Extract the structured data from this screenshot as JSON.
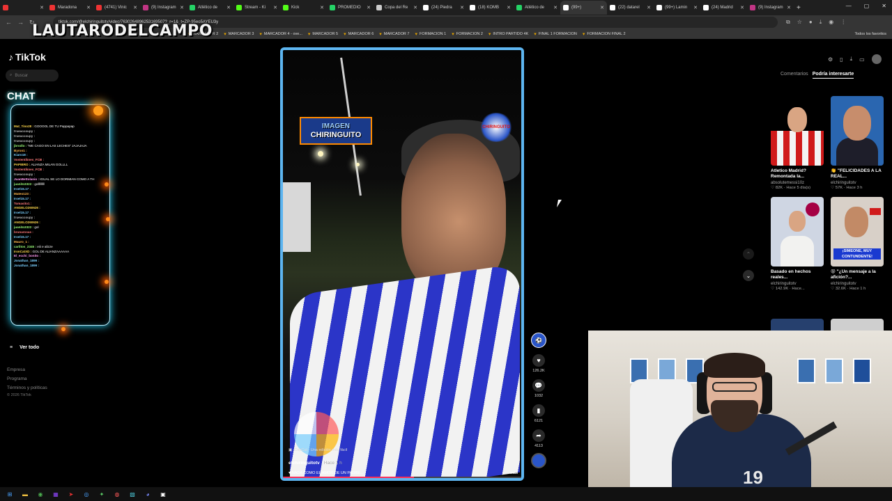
{
  "browser": {
    "tabs": [
      {
        "label": "",
        "color": "#e33"
      },
      {
        "label": "Maradona",
        "color": "#e33"
      },
      {
        "label": "(4741) Vinic",
        "color": "#e33"
      },
      {
        "label": "(9) Instagram",
        "color": "#c13584"
      },
      {
        "label": "Atlético de",
        "color": "#25d366"
      },
      {
        "label": "Stream - Ki",
        "color": "#53fc18"
      },
      {
        "label": "Kick",
        "color": "#53fc18"
      },
      {
        "label": "PROMEDIO",
        "color": "#25d366"
      },
      {
        "label": "Copa del Re",
        "color": "#ccc"
      },
      {
        "label": "(24) Piedra",
        "color": "#fff"
      },
      {
        "label": "(18) KOMB",
        "color": "#fff"
      },
      {
        "label": "Atlético de",
        "color": "#25d366"
      },
      {
        "label": "(99+)",
        "color": "#fff",
        "active": true
      },
      {
        "label": "(22) datarel",
        "color": "#fff"
      },
      {
        "label": "(99+) Lamin",
        "color": "#fff"
      },
      {
        "label": "(24) Madrid",
        "color": "#fff"
      },
      {
        "label": "(9) Instagram",
        "color": "#c13584"
      }
    ],
    "url": "tiktok.com/@elchiringuitotv/video/7630264896253169507?_r=1&_t=ZP-95eo5AYEU3y",
    "bookmarks": [
      "MARCADOR 2",
      "MARCADOR 3",
      "MARCADOR 4 - ove...",
      "MARCADOR 5",
      "MARCADOR 6",
      "MARCADOR 7",
      "FORMACION 1",
      "FORMACION 2",
      "INTRO PARTIDO 4K",
      "FINAL 1 FORMACION",
      "FORMACION FINAL 2"
    ],
    "bookmarks_all": "Todos los favoritos"
  },
  "streamer": {
    "name": "LAUTARODELCAMPO"
  },
  "tiktok": {
    "logo": "TikTok",
    "search_placeholder": "Buscar",
    "sidebar": {
      "see_all": "Ver todo",
      "footer": [
        "Empresa",
        "Programa",
        "Términos y políticas"
      ],
      "copyright": "© 2026 TikTok"
    }
  },
  "chat": {
    "title": "CHAT",
    "messages": [
      {
        "user": "Mat_Tino28 :",
        "text": "GOOOOL DE TU Pappapap",
        "color": "#ffd84d"
      },
      {
        "user": "trueaccoupy :",
        "text": "",
        "color": "#b8b8b8"
      },
      {
        "user": "trueaccoupy :",
        "text": "",
        "color": "#b8b8b8"
      },
      {
        "user": "trueaccoupy :",
        "text": "",
        "color": "#b8b8b8"
      },
      {
        "user": "jbrodlo :",
        "text": "\"ME CAGO EN LAS LECHES\" JAJAJAJA",
        "color": "#9cff7a"
      },
      {
        "user": "Byron1 :",
        "text": "",
        "color": "#ffb84d"
      },
      {
        "user": "Kiaro18 :",
        "text": "",
        "color": "#7ad0ff"
      },
      {
        "user": "Vostentiknes_FCB :",
        "text": "",
        "color": "#ff7a7a"
      },
      {
        "user": "PAPIBRO :",
        "text": "ALIANZA MILAN GOLLLL",
        "color": "#ffd84d"
      },
      {
        "user": "Vostentiknes_FCB :",
        "text": "",
        "color": "#ff7a7a"
      },
      {
        "user": "trueaccoupy :",
        "text": "",
        "color": "#b8b8b8"
      },
      {
        "user": "JuanBettolanio :",
        "text": "IGUAL SE LO DORMIAN COMO A TH",
        "color": "#ff9af0"
      },
      {
        "user": "juanito3322 :",
        "text": "golllllllll",
        "color": "#9cff7a"
      },
      {
        "user": "Iroel15.17 :",
        "text": "",
        "color": "#7ad0ff"
      },
      {
        "user": "Mateo123 :",
        "text": "",
        "color": "#ffb84d"
      },
      {
        "user": "Iroel15.17 :",
        "text": "",
        "color": "#7ad0ff"
      },
      {
        "user": "Tomasito1 :",
        "text": "",
        "color": "#ff7a7a"
      },
      {
        "user": "ANGELO260626 :",
        "text": "",
        "color": "#ffd84d"
      },
      {
        "user": "Iroel15.17 :",
        "text": "",
        "color": "#7ad0ff"
      },
      {
        "user": "trueaccoupy :",
        "text": "",
        "color": "#b8b8b8"
      },
      {
        "user": "ANGELO260626 :",
        "text": "",
        "color": "#ffd84d"
      },
      {
        "user": "juanito3322 :",
        "text": "gol",
        "color": "#9cff7a"
      },
      {
        "user": "brunarosas :",
        "text": "",
        "color": "#ff7a7a"
      },
      {
        "user": "Iroel15.17 :",
        "text": "",
        "color": "#7ad0ff"
      },
      {
        "user": "Mauro_1 :",
        "text": "",
        "color": "#ffb84d"
      },
      {
        "user": "carlitos_2345 :",
        "text": "eiii e alizze",
        "color": "#9cff7a"
      },
      {
        "user": "IronCatXD :",
        "text": "GOL DE ALIANZAAAAAA",
        "color": "#ffd84d"
      },
      {
        "user": "El_ecchi_bonito :",
        "text": "",
        "color": "#ff9af0"
      },
      {
        "user": "Jonathan_1899 :",
        "text": "",
        "color": "#7ad0ff"
      },
      {
        "user": "Jonathan_1899 :",
        "text": "",
        "color": "#7ad0ff"
      }
    ]
  },
  "video": {
    "badge_top": "IMAGEN",
    "badge_bottom": "CHIRINGUITO",
    "logo": "CHIRINGUITO",
    "capcut": "CapCut · Una edición más fácil",
    "username": "elchiringuitotv",
    "ago": "Hace 1 h",
    "description": "NADA COMO EL AMOR DE UN PADRE...",
    "more": "más",
    "progress": 0.55,
    "likes": "126.2K",
    "comments": "1032",
    "saves": "6121",
    "shares": "4113"
  },
  "right_panel": {
    "tabs": [
      {
        "label": "Comentarios",
        "active": false
      },
      {
        "label": "Podría interesarte",
        "active": true
      }
    ],
    "recommendations": [
      {
        "title": "Atletico Madrid? Remontada la...",
        "user": "absolutemessi10z",
        "likes": "82K",
        "ago": "Hace 5 día(s)",
        "thumb": "thumb1"
      },
      {
        "title": "👏 \"FELICIDADES A LA REAL...",
        "user": "elchiringuitotv",
        "likes": "57K",
        "ago": "Hace 3 h",
        "thumb": "thumb2"
      },
      {
        "title": "Basado en hechos reales...",
        "user": "elchiringuitotv",
        "likes": "142.9K",
        "ago": "Hace...",
        "thumb": "thumb3"
      },
      {
        "title": "😡 \"¿Un mensaje a la afición?...",
        "user": "elchiringuitotv",
        "likes": "32.6K",
        "ago": "Hace 1 h",
        "thumb": "thumb4"
      }
    ],
    "thumb4_caption": "¡SIMEONE, MUY CONTUNDENTE!"
  },
  "webcam": {
    "jersey_number": "19"
  }
}
